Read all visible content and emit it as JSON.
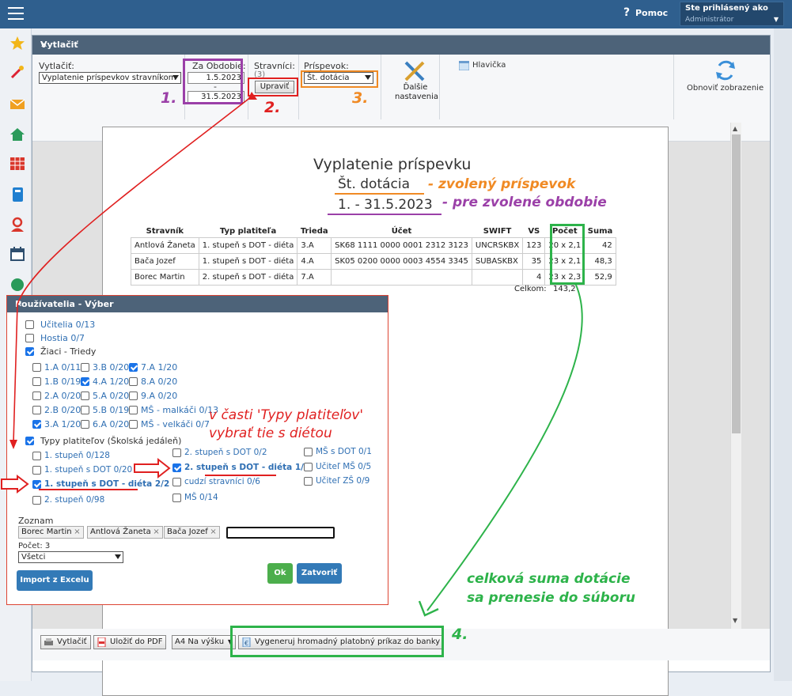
{
  "header": {
    "help_label": "Pomoc",
    "user_line1": "Ste prihlásený ako",
    "user_line2": "Administrátor"
  },
  "dialog": {
    "title": "Vytlačiť",
    "print_label": "Vytlačiť:",
    "print_value": "Vyplatenie príspevkov stravníkom",
    "period_label": "Za Obdobie:",
    "date_from": "1.5.2023",
    "date_sep": "-",
    "date_to": "31.5.2023",
    "boarders_label": "Stravníci:",
    "boarders_count": "(3)",
    "edit_button": "Upraviť",
    "contribution_label": "Príspevok:",
    "contribution_value": "Št. dotácia",
    "more_settings_1": "Ďalšie",
    "more_settings_2": "nastavenia",
    "header_label": "Hlavička",
    "refresh_label": "Obnoviť zobrazenie"
  },
  "annotations": {
    "n1": "1.",
    "n2": "2.",
    "n3": "3.",
    "n4": "4.",
    "chosen_contribution": "- zvolený príspevok",
    "chosen_period": "- pre zvolené obdobie",
    "choose_types_1": "v časti 'Typy platiteľov'",
    "choose_types_2": "vybrať tie s diétou",
    "total_1": "celková suma dotácie",
    "total_2": "sa prenesie do súboru"
  },
  "document": {
    "title": "Vyplatenie príspevku",
    "subtitle": "Št. dotácia",
    "period": "1. - 31.5.2023",
    "columns": [
      "Stravník",
      "Typ platiteľa",
      "Trieda",
      "Účet",
      "SWIFT",
      "VS",
      "Počet",
      "Suma"
    ],
    "rows": [
      [
        "Antlová Žaneta",
        "1. stupeň s DOT - diéta",
        "3.A",
        "SK68 1111 0000 0001 2312 3123",
        "UNCRSKBX",
        "123",
        "20 x 2,1",
        "42"
      ],
      [
        "Bača Jozef",
        "1. stupeň s DOT - diéta",
        "4.A",
        "SK05 0200 0000 0003 4554 3345",
        "SUBASKBX",
        "35",
        "23 x 2,1",
        "48,3"
      ],
      [
        "Borec Martin",
        "2. stupeň s DOT - diéta",
        "7.A",
        "",
        "",
        "4",
        "23 x 2,3",
        "52,9"
      ]
    ],
    "total_label": "Celkom:",
    "total_value": "143,2"
  },
  "bottom": {
    "print_btn": "Vytlačiť",
    "pdf_btn": "Uložiť do PDF",
    "page_format": "A4 Na výšku",
    "bank_btn": "Vygeneruj hromadný platobný príkaz do banky"
  },
  "users_dialog": {
    "title": "Používatelia - Výber",
    "teachers": "Učitelia 0/13",
    "guests": "Hostia 0/7",
    "pupils": "Žiaci - Triedy",
    "classes": [
      {
        "label": "1.A 0/11",
        "on": false
      },
      {
        "label": "3.B 0/20",
        "on": false
      },
      {
        "label": "7.A 1/20",
        "on": true
      },
      {
        "label": "1.B 0/19",
        "on": false
      },
      {
        "label": "4.A 1/20",
        "on": true
      },
      {
        "label": "8.A 0/20",
        "on": false
      },
      {
        "label": "2.A 0/20",
        "on": false
      },
      {
        "label": "5.A 0/20",
        "on": false
      },
      {
        "label": "9.A 0/20",
        "on": false
      },
      {
        "label": "2.B 0/20",
        "on": false
      },
      {
        "label": "5.B 0/19",
        "on": false
      },
      {
        "label": "MŠ - malkáči 0/13",
        "on": false
      },
      {
        "label": "3.A 1/20",
        "on": true
      },
      {
        "label": "6.A 0/20",
        "on": false
      },
      {
        "label": "MŠ - velkáči 0/7",
        "on": false
      }
    ],
    "payer_types_label": "Typy platiteľov (Školská jedáleň)",
    "payer_types": [
      {
        "label": "1. stupeň 0/128",
        "on": false
      },
      {
        "label": "1. stupeň s DOT 0/20",
        "on": false
      },
      {
        "label": "1. stupeň s DOT - diéta 2/2",
        "on": true
      },
      {
        "label": "2. stupeň 0/98",
        "on": false
      },
      {
        "label": "2. stupeň s DOT 0/2",
        "on": false
      },
      {
        "label": "2. stupeň s DOT - diéta 1/1",
        "on": true
      },
      {
        "label": "cudzí stravníci 0/6",
        "on": false
      },
      {
        "label": "MŠ 0/14",
        "on": false
      },
      {
        "label": "MŠ s DOT 0/1",
        "on": false
      },
      {
        "label": "Učiteľ MŠ 0/5",
        "on": false
      },
      {
        "label": "Učiteľ ZŠ 0/9",
        "on": false
      }
    ],
    "list_label": "Zoznam",
    "chips": [
      "Borec Martin",
      "Antlová Žaneta",
      "Bača Jozef"
    ],
    "count_label": "Počet: 3",
    "filter_value": "Všetci",
    "import_btn": "Import z Excelu",
    "ok_btn": "Ok",
    "close_btn": "Zatvoriť"
  },
  "colors": {
    "purple": "#9b40a8",
    "red": "#e02020",
    "orange": "#f08a24",
    "green": "#2db34a",
    "header": "#2f5f8e"
  }
}
